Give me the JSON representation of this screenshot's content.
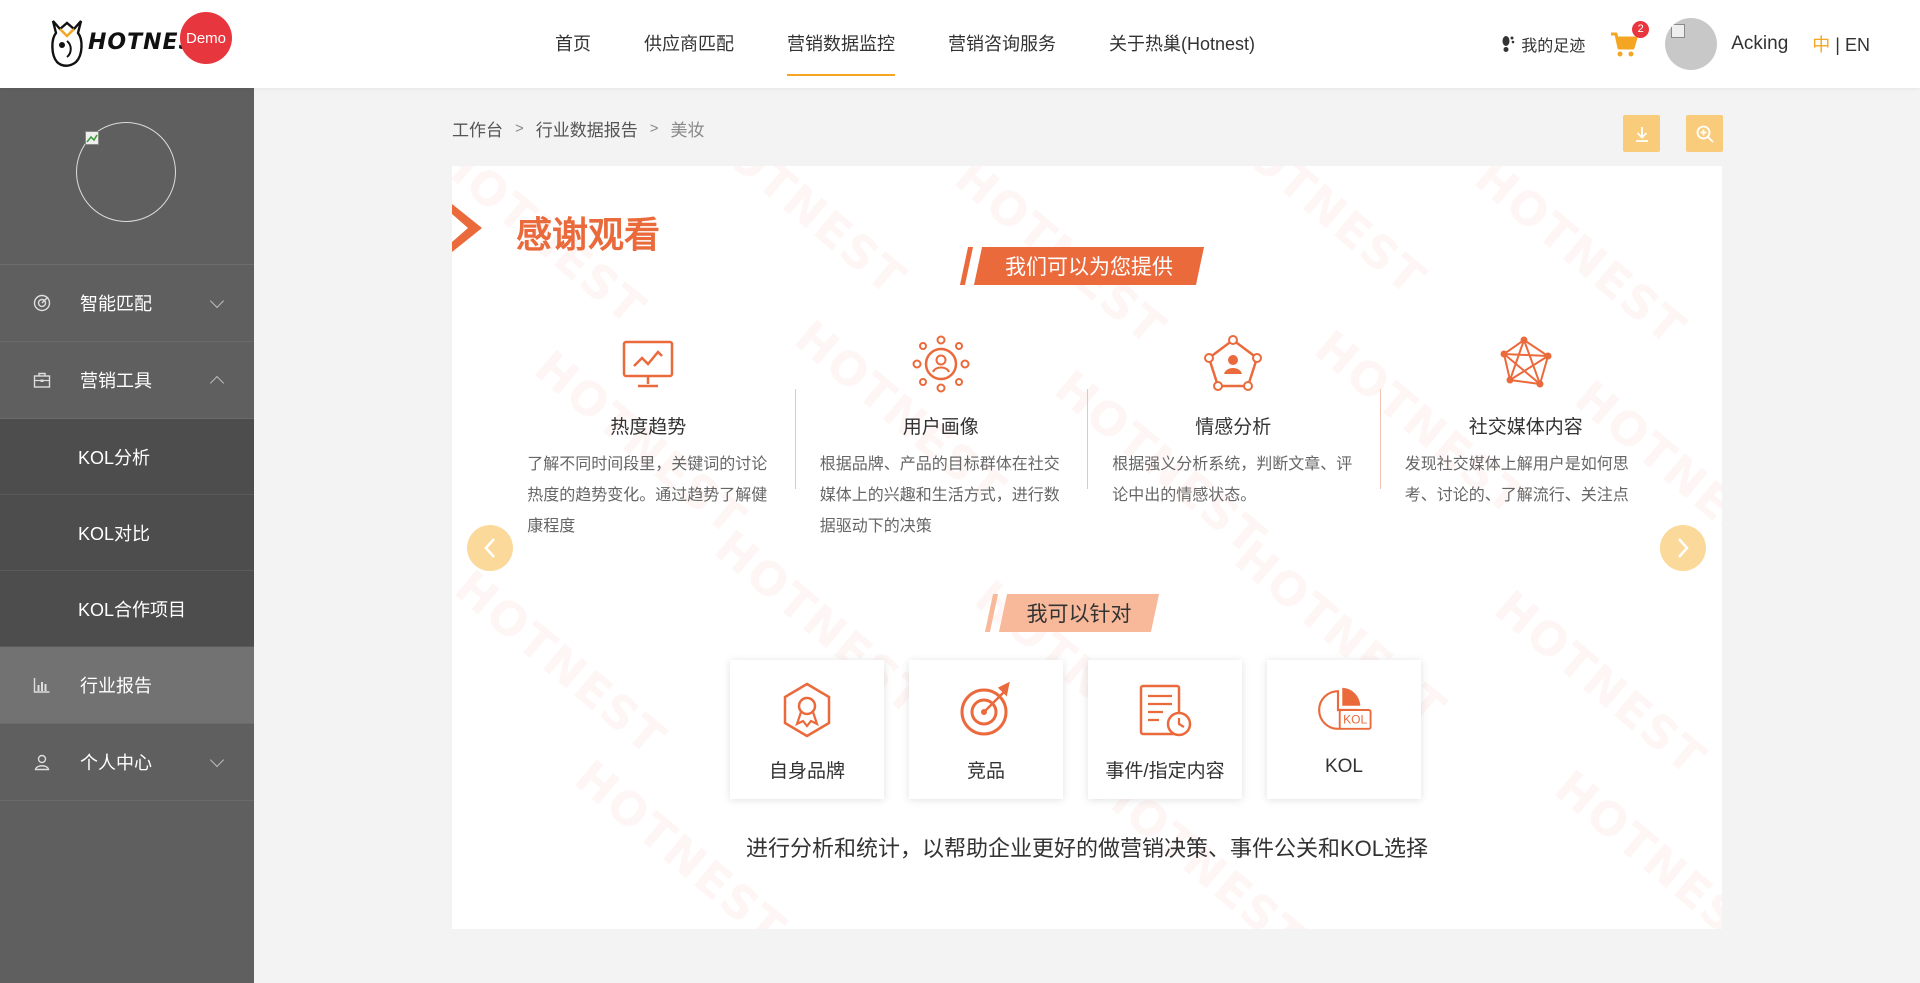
{
  "header": {
    "logo_text": "HOTNEST",
    "demo_badge": "Demo",
    "nav": [
      {
        "label": "首页"
      },
      {
        "label": "供应商匹配"
      },
      {
        "label": "营销数据监控"
      },
      {
        "label": "营销咨询服务"
      },
      {
        "label": "关于热巢(Hotnest)"
      }
    ],
    "active_nav": "营销数据监控",
    "footprint": "我的足迹",
    "cart_count": "2",
    "username": "Acking",
    "lang_zh": "中",
    "lang_sep": "|",
    "lang_en": "EN"
  },
  "sidebar": {
    "items": [
      {
        "label": "智能匹配",
        "icon": "target-icon"
      },
      {
        "label": "营销工具",
        "icon": "briefcase-icon"
      },
      {
        "label": "KOL分析"
      },
      {
        "label": "KOL对比"
      },
      {
        "label": "KOL合作项目"
      },
      {
        "label": "行业报告",
        "icon": "bar-chart-icon"
      },
      {
        "label": "个人中心",
        "icon": "user-icon"
      }
    ]
  },
  "breadcrumb": {
    "items": [
      "工作台",
      "行业数据报告",
      "美妆"
    ],
    "separator": ">"
  },
  "card": {
    "title": "感谢观看",
    "banner1": "我们可以为您提供",
    "features": [
      {
        "title": "热度趋势",
        "desc": "了解不同时间段里，关键词的讨论热度的趋势变化。通过趋势了解健康程度",
        "icon": "trend-monitor-icon"
      },
      {
        "title": "用户画像",
        "desc": "根据品牌、产品的目标群体在社交媒体上的兴趣和生活方式，进行数据驱动下的决策",
        "icon": "user-portrait-icon"
      },
      {
        "title": "情感分析",
        "desc": "根据强义分析系统，判断文章、评论中出的情感状态。",
        "icon": "sentiment-network-icon"
      },
      {
        "title": "社交媒体内容",
        "desc": "发现社交媒体上解用户是如何思考、讨论的、了解流行、关注点",
        "icon": "social-network-icon"
      }
    ],
    "banner2": "我可以针对",
    "targets": [
      {
        "label": "自身品牌",
        "icon": "brand-badge-icon"
      },
      {
        "label": "竞品",
        "icon": "competitor-target-icon"
      },
      {
        "label": "事件/指定内容",
        "icon": "event-document-icon"
      },
      {
        "label": "KOL",
        "icon": "kol-pie-icon"
      }
    ],
    "kol_icon_text": "KOL",
    "summary": "进行分析和统计，以帮助企业更好的做营销决策、事件公关和KOL选择",
    "watermark": "HOTNEST"
  },
  "colors": {
    "accent": "#ea6a3c",
    "nav_underline": "#f4a623",
    "sidebar_bg": "#5f5f5f",
    "sidebar_sub_bg": "#4d4d4d",
    "action_btn": "#f8cc7a",
    "badge_red": "#e8363e"
  }
}
